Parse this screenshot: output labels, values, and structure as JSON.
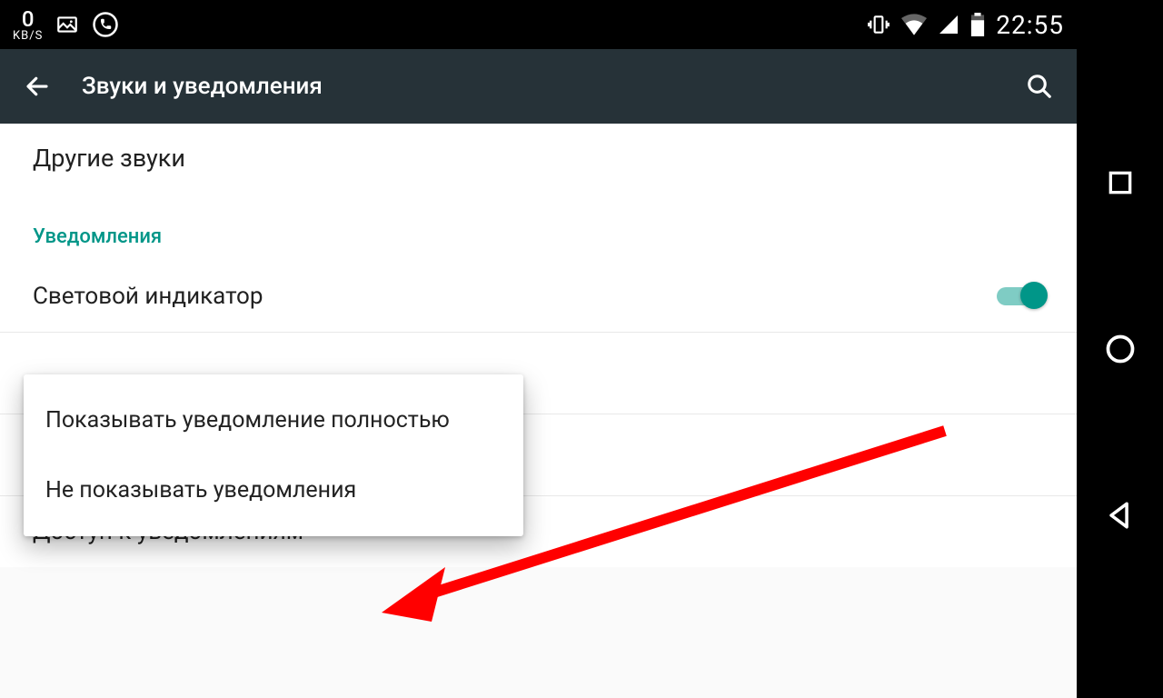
{
  "statusbar": {
    "speed_value": "0",
    "speed_unit": "KB/S",
    "time": "22:55"
  },
  "actionbar": {
    "title": "Звуки и уведомления"
  },
  "content": {
    "other_sounds": "Другие звуки",
    "section_notifications": "Уведомления",
    "light_indicator": "Световой индикатор",
    "notification_access": "Доступ к уведомлениям"
  },
  "popup": {
    "option_show_full": "Показывать уведомление полностью",
    "option_hide": "Не показывать уведомления"
  }
}
